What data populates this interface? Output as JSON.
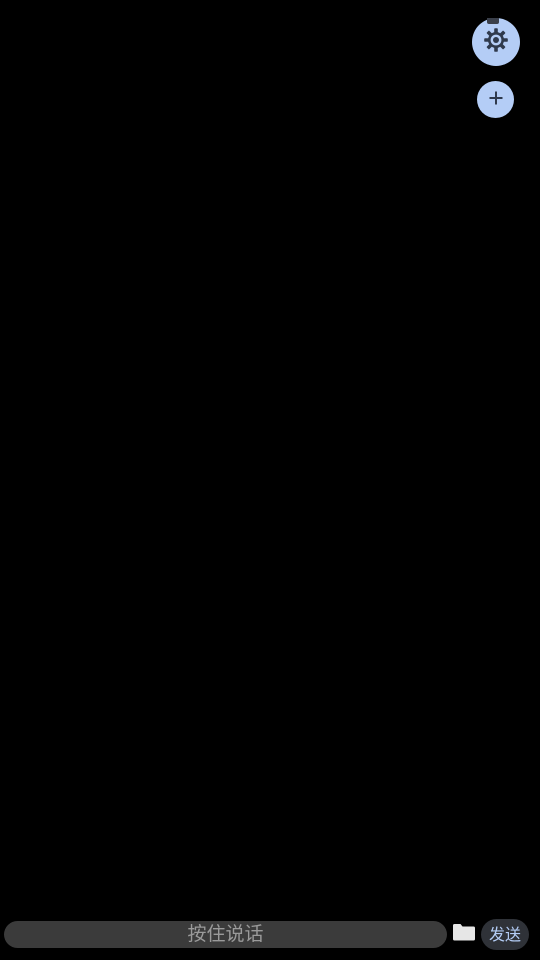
{
  "colors": {
    "background": "#000000",
    "fab_fill": "#b4cdf6",
    "fab_icon": "#2f3a4d",
    "input_fill": "#3b3b3b",
    "input_text": "#9a9a9a",
    "send_fill": "#2f3238",
    "send_text": "#b4cdf6",
    "folder_icon": "#e6e6e6"
  },
  "top_actions": {
    "settings_icon": "gear-icon",
    "add_icon": "plus-icon"
  },
  "bottom_bar": {
    "voice_hint": "按住说话",
    "file_icon": "folder-icon",
    "send_label": "发送"
  }
}
